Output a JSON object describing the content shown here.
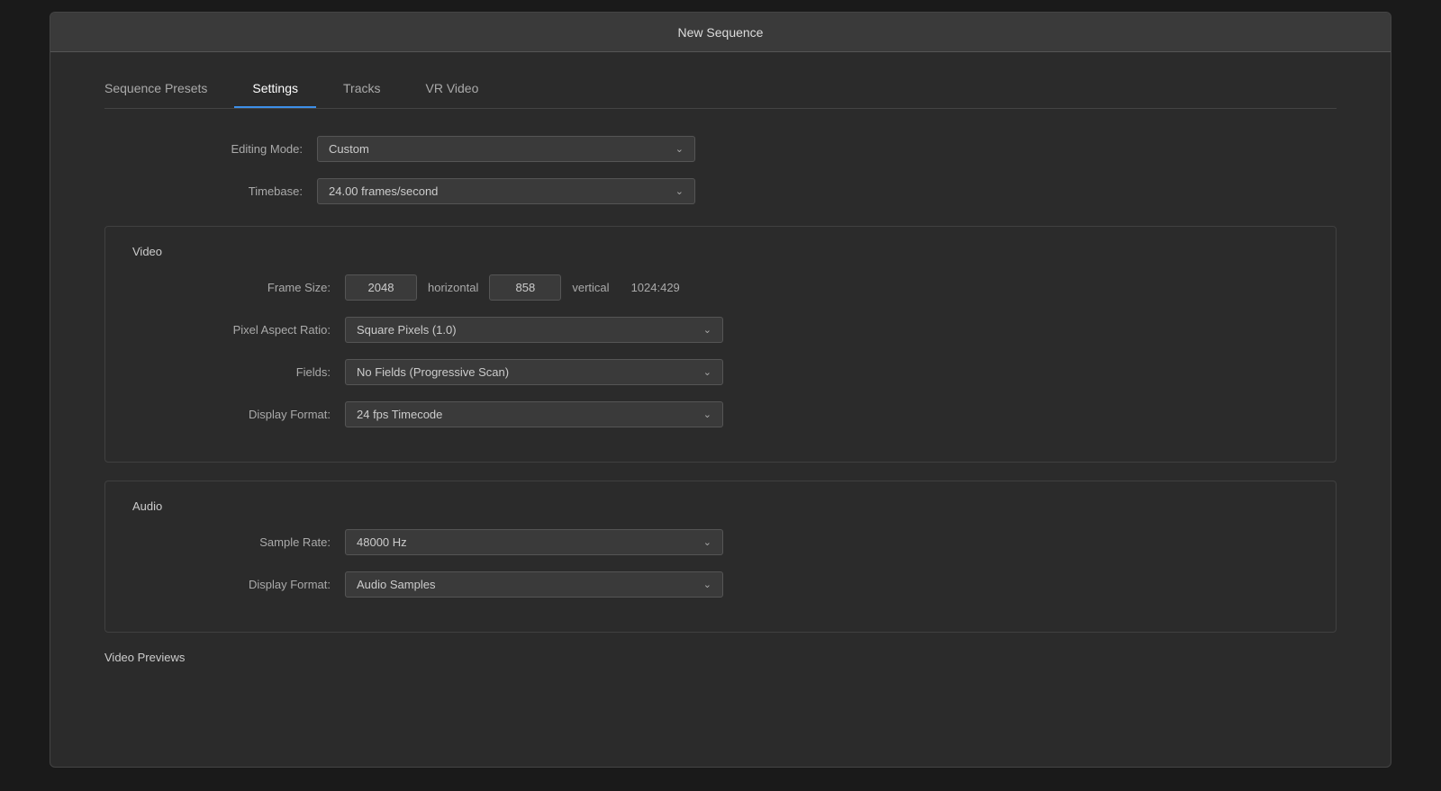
{
  "window": {
    "title": "New Sequence"
  },
  "tabs": [
    {
      "id": "sequence-presets",
      "label": "Sequence Presets",
      "active": false
    },
    {
      "id": "settings",
      "label": "Settings",
      "active": true
    },
    {
      "id": "tracks",
      "label": "Tracks",
      "active": false
    },
    {
      "id": "vr-video",
      "label": "VR Video",
      "active": false
    }
  ],
  "top_fields": {
    "editing_mode_label": "Editing Mode:",
    "editing_mode_value": "Custom",
    "timebase_label": "Timebase:",
    "timebase_value": "24.00  frames/second"
  },
  "video_section": {
    "title": "Video",
    "frame_size_label": "Frame Size:",
    "horizontal_value": "2048",
    "horizontal_label": "horizontal",
    "vertical_value": "858",
    "vertical_label": "vertical",
    "ratio_value": "1024:429",
    "pixel_aspect_label": "Pixel Aspect Ratio:",
    "pixel_aspect_value": "Square Pixels (1.0)",
    "fields_label": "Fields:",
    "fields_value": "No Fields (Progressive Scan)",
    "display_format_label": "Display Format:",
    "display_format_value": "24 fps Timecode"
  },
  "audio_section": {
    "title": "Audio",
    "sample_rate_label": "Sample Rate:",
    "sample_rate_value": "48000 Hz",
    "display_format_label": "Display Format:",
    "display_format_value": "Audio Samples"
  },
  "video_previews": {
    "title": "Video Previews"
  },
  "colors": {
    "active_tab_underline": "#3d8fe8"
  }
}
